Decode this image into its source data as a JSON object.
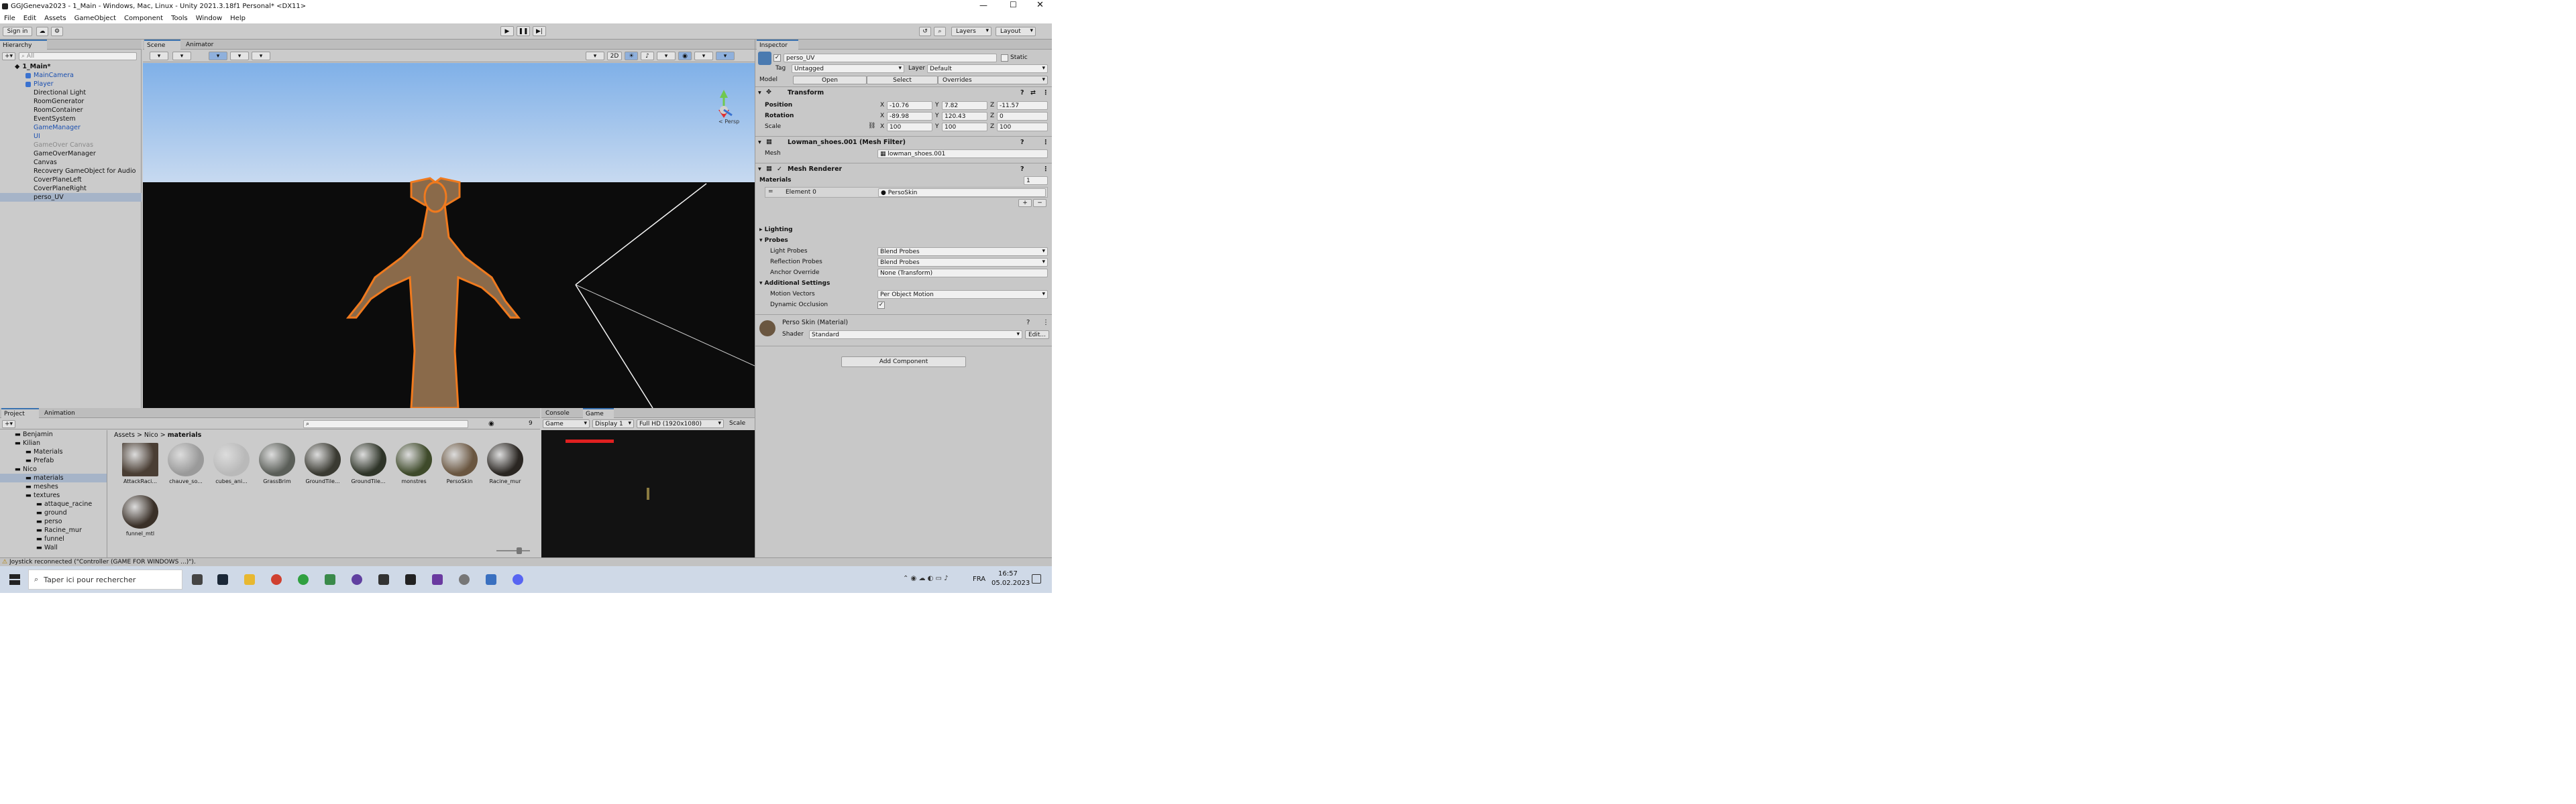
{
  "window": {
    "title": "GGJGeneva2023 - 1_Main - Windows, Mac, Linux - Unity 2021.3.18f1 Personal* <DX11>"
  },
  "menu": [
    "File",
    "Edit",
    "Assets",
    "GameObject",
    "Component",
    "Tools",
    "Window",
    "Help"
  ],
  "toolbar": {
    "sign_in": "Sign in",
    "layers": "Layers",
    "layout": "Layout"
  },
  "hierarchy": {
    "tab": "Hierarchy",
    "search_placeholder": "All",
    "scene": "1_Main*",
    "items": [
      "MainCamera",
      "Player",
      "Directional Light",
      "RoomGenerator",
      "RoomContainer",
      "EventSystem",
      "GameManager",
      "UI",
      "GameOver Canvas",
      "GameOverManager",
      "Canvas",
      "Recovery GameObject for Audio",
      "CoverPlaneLeft",
      "CoverPlaneRight",
      "perso_UV"
    ]
  },
  "scene": {
    "tabs": [
      "Scene",
      "Animator"
    ],
    "mode_2d": "2D",
    "persp": "< Persp"
  },
  "inspector": {
    "tab": "Inspector",
    "object_name": "perso_UV",
    "static_label": "Static",
    "tag_label": "Tag",
    "tag_value": "Untagged",
    "layer_label": "Layer",
    "layer_value": "Default",
    "model_label": "Model",
    "open": "Open",
    "select": "Select",
    "overrides": "Overrides",
    "transform": {
      "title": "Transform",
      "position_label": "Position",
      "rotation_label": "Rotation",
      "scale_label": "Scale",
      "position": {
        "x": "-10.76",
        "y": "7.82",
        "z": "-11.57"
      },
      "rotation": {
        "x": "-89.98",
        "y": "120.43",
        "z": "0"
      },
      "scale": {
        "x": "100",
        "y": "100",
        "z": "100"
      }
    },
    "mesh_filter": {
      "title": "Lowman_shoes.001 (Mesh Filter)",
      "mesh_label": "Mesh",
      "mesh_value": "lowman_shoes.001"
    },
    "mesh_renderer": {
      "title": "Mesh Renderer",
      "materials_label": "Materials",
      "materials_count": "1",
      "element0_label": "Element 0",
      "element0_value": "PersoSkin",
      "lighting": "Lighting",
      "probes": "Probes",
      "light_probes_label": "Light Probes",
      "light_probes_value": "Blend Probes",
      "reflection_probes_label": "Reflection Probes",
      "reflection_probes_value": "Blend Probes",
      "anchor_override_label": "Anchor Override",
      "anchor_override_value": "None (Transform)",
      "additional_settings": "Additional Settings",
      "motion_vectors_label": "Motion Vectors",
      "motion_vectors_value": "Per Object Motion",
      "dynamic_occlusion_label": "Dynamic Occlusion"
    },
    "material": {
      "title": "Perso Skin (Material)",
      "shader_label": "Shader",
      "shader_value": "Standard",
      "edit": "Edit..."
    },
    "add_component": "Add Component"
  },
  "project": {
    "tabs": [
      "Project",
      "Animation"
    ],
    "tree": [
      "Benjamin",
      "Kilian",
      "Materials",
      "Prefab",
      "Nico",
      "materials",
      "meshes",
      "textures",
      "attaque_racine",
      "ground",
      "perso",
      "Racine_mur",
      "funnel",
      "Wall"
    ],
    "breadcrumb": [
      "Assets",
      "Nico",
      "materials"
    ],
    "assets": [
      {
        "name": "AttackRaci...",
        "color": "#4a3e34"
      },
      {
        "name": "chauve_so...",
        "color": "#9a9a9a"
      },
      {
        "name": "cubes_ani...",
        "color": "#b9b9b9"
      },
      {
        "name": "GrassBrim",
        "color": "#5a5e58"
      },
      {
        "name": "GroundTile...",
        "color": "#3a3a32"
      },
      {
        "name": "GroundTile...",
        "color": "#2e3428"
      },
      {
        "name": "monstres",
        "color": "#3e4a2a"
      },
      {
        "name": "PersoSkin",
        "color": "#6a5640"
      },
      {
        "name": "Racine_mur",
        "color": "#2a2622"
      },
      {
        "name": "funnel_mtl",
        "color": "#3a3028"
      }
    ],
    "item_count": "9"
  },
  "game": {
    "tabs": [
      "Console",
      "Game"
    ],
    "display_mode": "Game",
    "display": "Display 1",
    "resolution": "Full HD (1920x1080)",
    "scale": "Scale"
  },
  "status": {
    "message": "Joystick reconnected (\"Controller (GAME FOR WINDOWS ...)\")."
  },
  "taskbar": {
    "search_placeholder": "Taper ici pour rechercher",
    "lang": "FRA",
    "time": "16:57",
    "date": "05.02.2023"
  },
  "colors": {
    "accent": "#3a72b0",
    "selection": "#a6b4c8",
    "outline": "#f07a1e",
    "skin": "#8a6a4a"
  }
}
